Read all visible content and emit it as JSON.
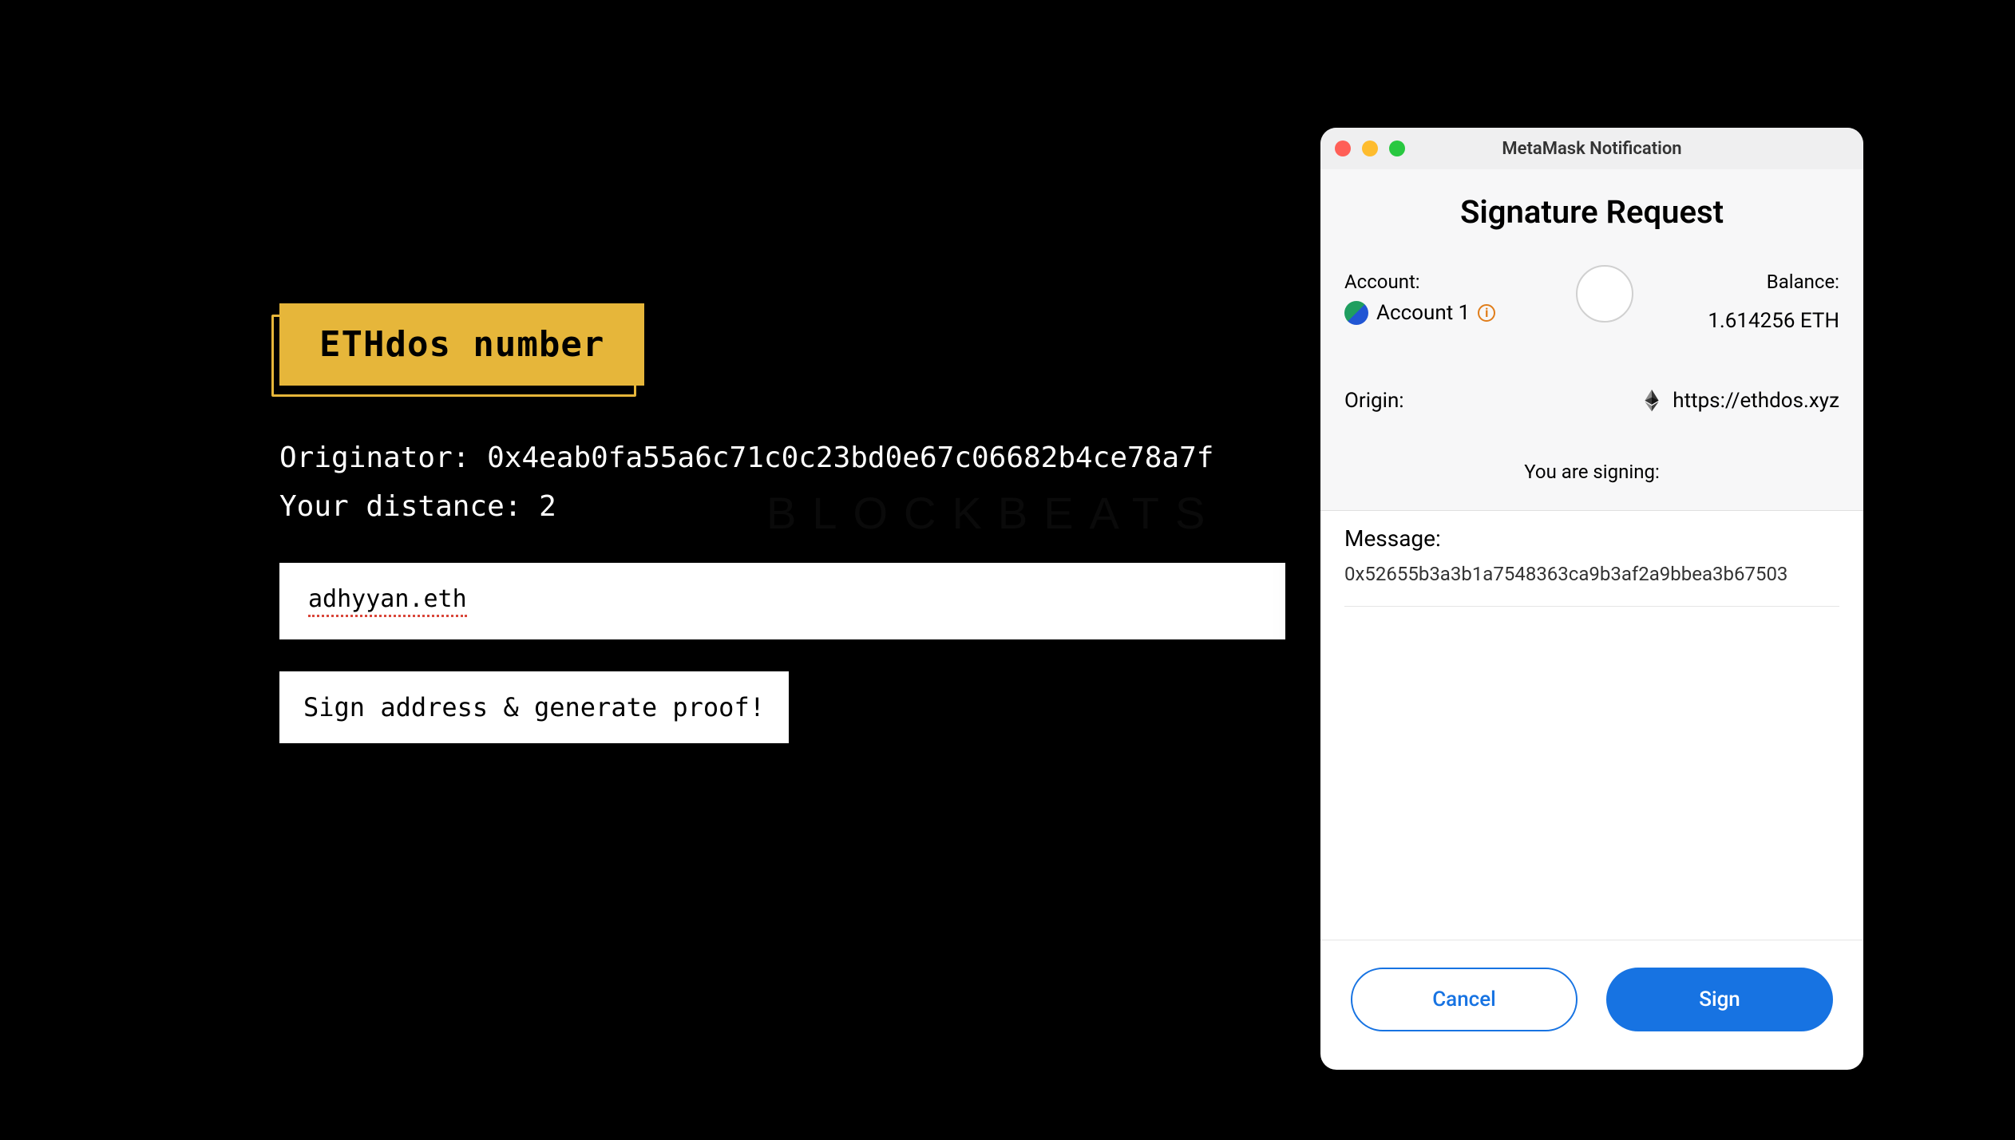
{
  "app": {
    "title": "ETHdos number",
    "originator_label": "Originator:",
    "originator_value": "0x4eab0fa55a6c71c0c23bd0e67c06682b4ce78a7f",
    "distance_label": "Your distance:",
    "distance_value": "2",
    "input_value": "adhyyan.eth",
    "action_label": "Sign address & generate proof!"
  },
  "watermark": "BLOCKBEATS",
  "popup": {
    "window_title": "MetaMask Notification",
    "heading": "Signature Request",
    "account_label": "Account:",
    "account_name": "Account 1",
    "balance_label": "Balance:",
    "balance_value": "1.614256 ETH",
    "origin_label": "Origin:",
    "origin_value": "https://ethdos.xyz",
    "signing_label": "You are signing:",
    "message_label": "Message:",
    "message_value": "0x52655b3a3b1a7548363ca9b3af2a9bbea3b67503",
    "cancel_label": "Cancel",
    "sign_label": "Sign"
  },
  "icons": {
    "account_avatar": "account-avatar-icon",
    "info": "info-icon",
    "ethereum": "ethereum-icon",
    "traffic_red": "close-icon",
    "traffic_yellow": "minimize-icon",
    "traffic_green": "maximize-icon"
  }
}
